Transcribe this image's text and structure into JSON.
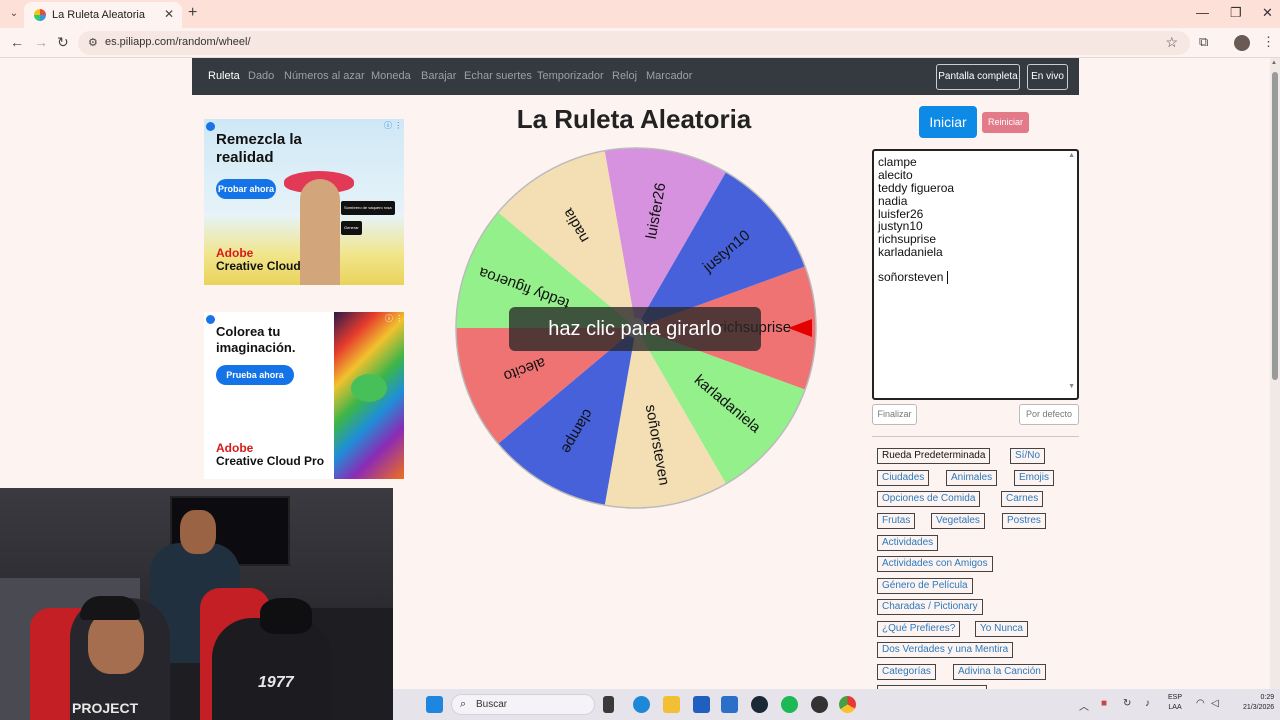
{
  "browser": {
    "tab_title": "La Ruleta Aleatoria",
    "url": "es.piliapp.com/random/wheel/",
    "new_tab": "+",
    "close_tab": "✕"
  },
  "nav": {
    "links": [
      "Ruleta",
      "Dado",
      "Números al azar",
      "Moneda",
      "Barajar",
      "Echar suertes",
      "Temporizador",
      "Reloj",
      "Marcador"
    ],
    "fullscreen_label": "Pantalla completa",
    "live_label": "En vivo"
  },
  "ads": {
    "ad1": {
      "headline": "Remezcla la realidad",
      "cta": "Probar ahora",
      "brand_line1": "Adobe",
      "brand_line2": "Creative Cloud",
      "pill1": "Sombrero de vaquero rosa",
      "pill2": "Generar"
    },
    "ad2": {
      "headline": "Colorea tu imaginación.",
      "cta": "Prueba ahora",
      "brand_line1": "Adobe",
      "brand_line2": "Creative Cloud Pro"
    }
  },
  "wheel": {
    "title": "La Ruleta Aleatoria",
    "overlay_text": "haz clic para girarlo",
    "segments": [
      {
        "label": "richsuprise",
        "color": "#ef7373"
      },
      {
        "label": "karladaniela",
        "color": "#93f08a"
      },
      {
        "label": "soñorsteven",
        "color": "#f4dfb4"
      },
      {
        "label": "clampe",
        "color": "#4661d9"
      },
      {
        "label": "alecito",
        "color": "#ef7373"
      },
      {
        "label": "teddy figueroa",
        "color": "#93f08a"
      },
      {
        "label": "nadia",
        "color": "#f4dfb4"
      },
      {
        "label": "luisfer26",
        "color": "#d692de"
      },
      {
        "label": "justyn10",
        "color": "#4661d9"
      }
    ],
    "pointer_color": "#e50000"
  },
  "controls": {
    "start_label": "Iniciar",
    "reset_label": "Reiniciar",
    "names": [
      "clampe",
      "alecito",
      "teddy figueroa",
      "nadia",
      "luisfer26",
      "justyn10",
      "richsuprise",
      "karladaniela",
      "",
      "soñorsteven"
    ],
    "finish_label": "Finalizar",
    "default_label": "Por defecto"
  },
  "presets": {
    "items": [
      "Rueda Predeterminada",
      "Sí/No",
      "Ciudades",
      "Animales",
      "Emojis",
      "Opciones de Comida",
      "Carnes",
      "Frutas",
      "Vegetales",
      "Postres",
      "Actividades",
      "Actividades con Amigos",
      "Género de Película",
      "Charadas / Pictionary",
      "¿Qué Prefieres?",
      "Yo Nunca",
      "Dos Verdades y una Mentira",
      "Categorías",
      "Adivina la Canción"
    ]
  },
  "webcam": {
    "shirt_text": "1977",
    "shirt_text2": "PROJECT"
  },
  "taskbar": {
    "search_placeholder": "Buscar",
    "lang_top": "ESP",
    "lang_bottom": "LAA",
    "time": "0:29",
    "date": "21/3/2026"
  },
  "colors": {
    "nav_bg": "#343a40",
    "start_button": "#0d8ae6",
    "reset_button": "#e37a8a",
    "link": "#2a7ac0",
    "page_bg": "#fdf4f1"
  }
}
